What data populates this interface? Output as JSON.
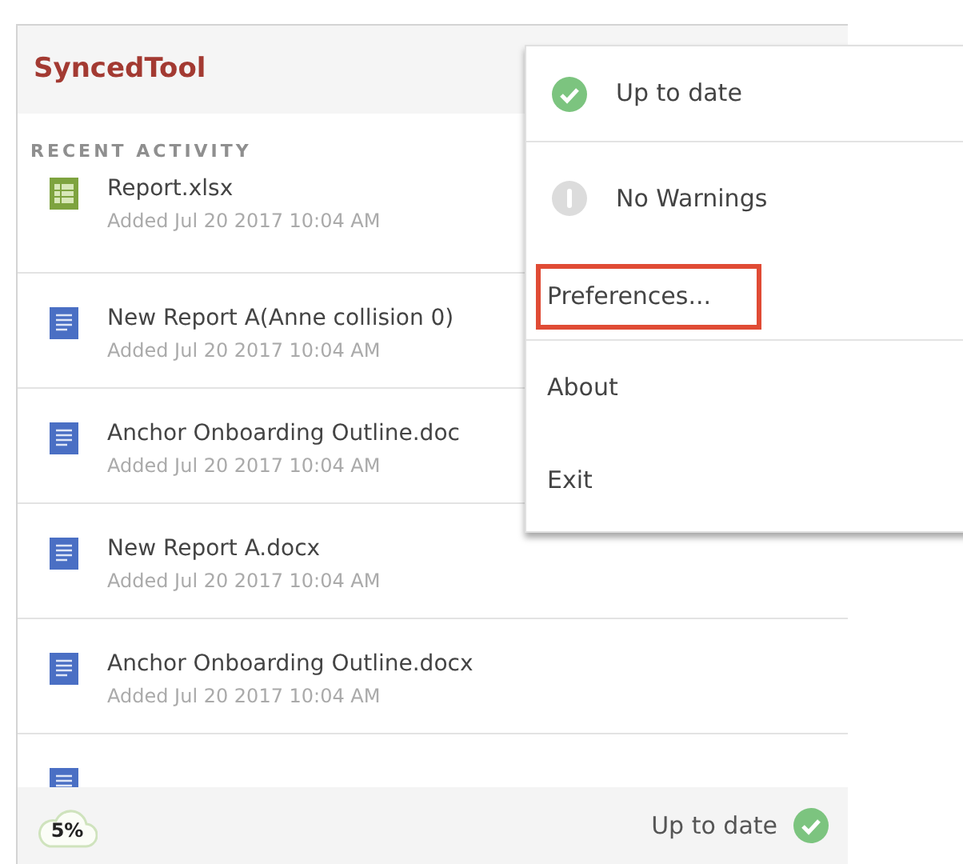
{
  "app": {
    "title": "SyncedTool"
  },
  "recent_activity": {
    "heading": "RECENT ACTIVITY",
    "items": [
      {
        "kind": "spreadsheet",
        "name": "Report.xlsx",
        "detail": "Added Jul 20 2017 10:04 AM"
      },
      {
        "kind": "document",
        "name": "New Report A(Anne collision 0)",
        "detail": "Added Jul 20 2017 10:04 AM"
      },
      {
        "kind": "document",
        "name": "Anchor Onboarding Outline.doc",
        "detail": "Added Jul 20 2017 10:04 AM"
      },
      {
        "kind": "document",
        "name": "New Report A.docx",
        "detail": "Added Jul 20 2017 10:04 AM"
      },
      {
        "kind": "document",
        "name": "Anchor Onboarding Outline.docx",
        "detail": "Added Jul 20 2017 10:04 AM"
      },
      {
        "kind": "document"
      }
    ]
  },
  "status_bar": {
    "progress": "5%",
    "status": "Up to date"
  },
  "menu": {
    "items": [
      {
        "kind": "ok",
        "label": "Up to date",
        "highlighted": false,
        "divider_after": true
      },
      {
        "kind": "warning",
        "label": "No Warnings",
        "highlighted": false,
        "divider_after": false
      },
      {
        "kind": "plain",
        "label": "Preferences...",
        "highlighted": true,
        "divider_after": true
      },
      {
        "kind": "plain",
        "label": "About",
        "highlighted": false,
        "divider_after": false
      },
      {
        "kind": "plain",
        "label": "Exit",
        "highlighted": false,
        "divider_after": false
      }
    ]
  }
}
